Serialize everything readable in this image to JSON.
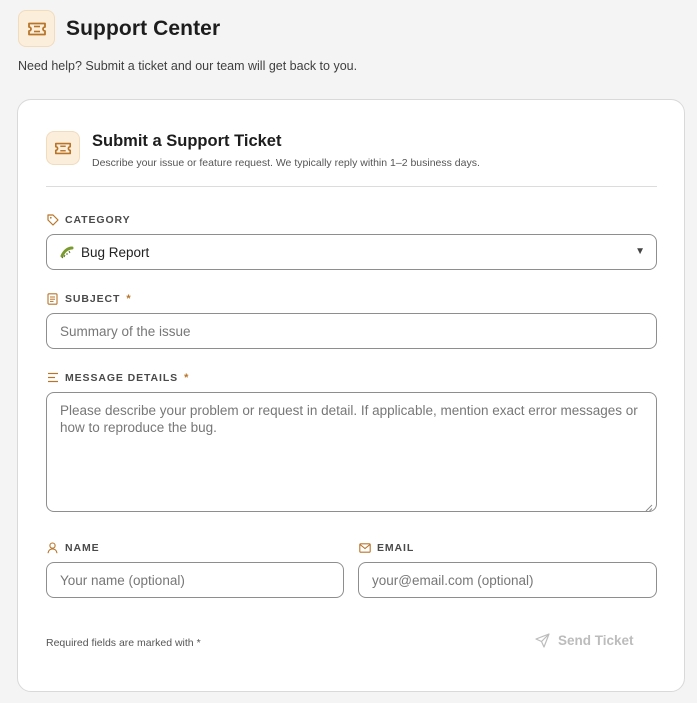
{
  "app": {
    "title": "Support Center",
    "subtitle": "Need help? Submit a ticket and our team will get back to you.",
    "logo_icon": "ticket-icon"
  },
  "form": {
    "title": "Submit a Support Ticket",
    "description": "Describe your issue or feature request. We typically reply within 1–2 business days.",
    "category": {
      "label": "CATEGORY",
      "icon": "tag-icon",
      "selected_value": "Bug Report",
      "option_icon": "bug-icon"
    },
    "subject": {
      "label": "SUBJECT",
      "required_mark": "*",
      "icon": "document-icon",
      "placeholder": "Summary of the issue"
    },
    "message": {
      "label": "MESSAGE DETAILS",
      "required_mark": "*",
      "icon": "lines-icon",
      "placeholder": "Please describe your problem or request in detail. If applicable, mention exact error messages or how to reproduce the bug."
    },
    "name": {
      "label": "NAME",
      "icon": "user-icon",
      "placeholder": "Your name (optional)"
    },
    "email": {
      "label": "EMAIL",
      "icon": "mail-icon",
      "placeholder": "your@email.com (optional)"
    },
    "footer_note": "Required fields are marked with *",
    "submit_label": "Send Ticket",
    "submit_icon": "send-icon"
  },
  "colors": {
    "accent": "#b8752a",
    "accent_bg": "#fbeedb",
    "disabled_text": "#bcbcbc"
  }
}
